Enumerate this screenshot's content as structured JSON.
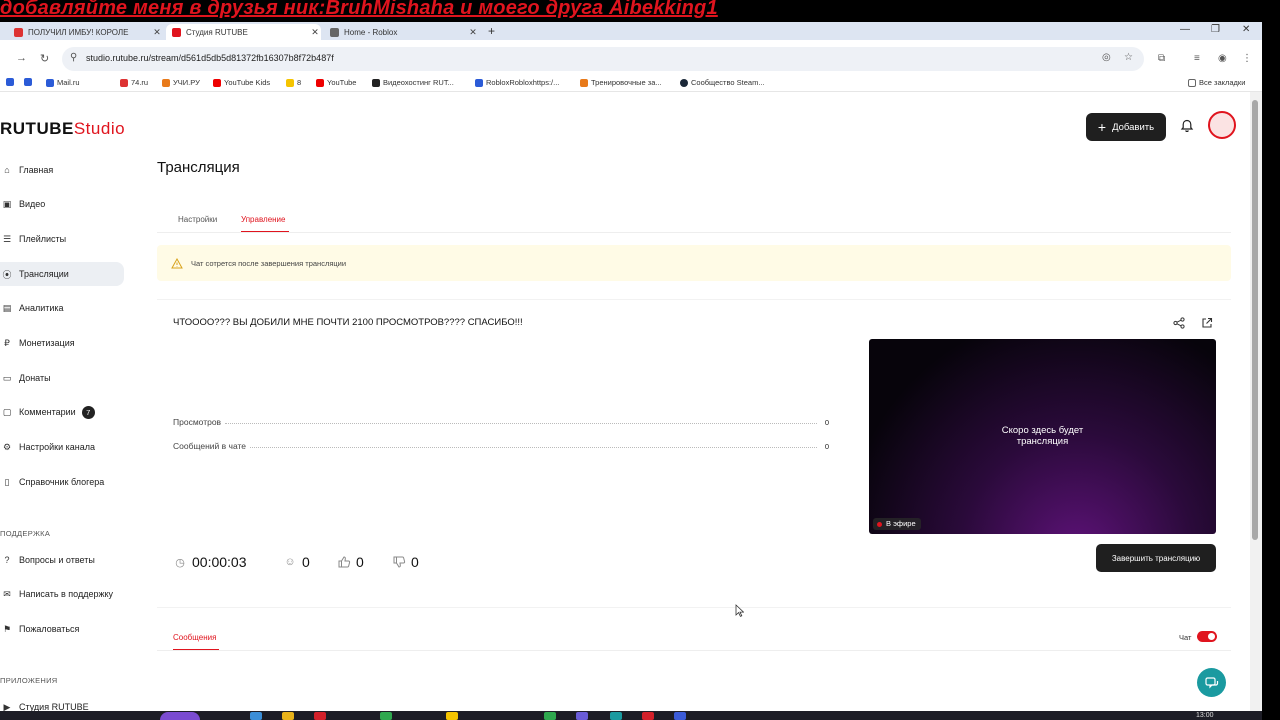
{
  "overlay": {
    "text": "добавляйте меня в друзья ник:BruhMishaha и моего друга Aibekking1"
  },
  "browser": {
    "tabs": [
      {
        "title": "ПОЛУЧИЛ ИМБУ! КОРОЛЕ",
        "favicon_color": "#d33"
      },
      {
        "title": "Студия RUTUBE",
        "favicon_color": "#e0141e"
      },
      {
        "title": "Home - Roblox",
        "favicon_color": "#666"
      }
    ],
    "new_tab": "+",
    "url": "studio.rutube.ru/stream/d561d5db5d81372fb16307b8f72b487f",
    "bookmarks": [
      {
        "label": "",
        "color": "#2b5bd7"
      },
      {
        "label": "",
        "color": "#2b5bd7"
      },
      {
        "label": "Mail.ru",
        "color": "#2b5bd7"
      },
      {
        "label": "74.ru",
        "color": "#d33"
      },
      {
        "label": "УЧИ.РУ",
        "color": "#e87a1a"
      },
      {
        "label": "YouTube Kids",
        "color": "#e00"
      },
      {
        "label": "8",
        "color": "#f5c400"
      },
      {
        "label": "YouTube",
        "color": "#e00"
      },
      {
        "label": "Видеохостинг RUT...",
        "color": "#222"
      },
      {
        "label": "RobloxRobloxhttps:/...",
        "color": "#2b5bd7"
      },
      {
        "label": "Тренировочные за...",
        "color": "#e87a1a"
      },
      {
        "label": "Сообщество Steam...",
        "color": "#1b2838"
      }
    ],
    "all_bookmarks": "Все закладки"
  },
  "header": {
    "logo_main": "RUTUBE",
    "logo_studio": "Studio",
    "add_label": "Добавить"
  },
  "sidebar": {
    "items": [
      {
        "label": "Главная",
        "icon": "home-icon"
      },
      {
        "label": "Видео",
        "icon": "video-icon"
      },
      {
        "label": "Плейлисты",
        "icon": "playlist-icon"
      },
      {
        "label": "Трансляции",
        "icon": "broadcast-icon"
      },
      {
        "label": "Аналитика",
        "icon": "analytics-icon"
      },
      {
        "label": "Монетизация",
        "icon": "ruble-icon"
      },
      {
        "label": "Донаты",
        "icon": "wallet-icon"
      },
      {
        "label": "Комментарии",
        "icon": "comment-icon",
        "badge": "7"
      },
      {
        "label": "Настройки канала",
        "icon": "settings-icon"
      },
      {
        "label": "Справочник блогера",
        "icon": "book-icon"
      }
    ],
    "support_title": "ПОДДЕРЖКА",
    "support_items": [
      {
        "label": "Вопросы и ответы",
        "icon": "question-icon"
      },
      {
        "label": "Написать в поддержку",
        "icon": "mail-icon"
      },
      {
        "label": "Пожаловаться",
        "icon": "flag-icon"
      }
    ],
    "apps_title": "ПРИЛОЖЕНИЯ",
    "apps_items": [
      {
        "label": "Студия RUTUBE",
        "icon": "studio-icon"
      }
    ]
  },
  "main": {
    "title": "Трансляция",
    "tabs": [
      {
        "label": "Настройки"
      },
      {
        "label": "Управление"
      }
    ],
    "warning": "Чат сотрется после завершения трансляции",
    "stream_title": "ЧТОООО??? ВЫ ДОБИЛИ МНЕ ПОЧТИ 2100 ПРОСМОТРОВ???? СПАСИБО!!!",
    "stats": [
      {
        "label": "Просмотров",
        "value": "0"
      },
      {
        "label": "Сообщений в чате",
        "value": "0"
      }
    ],
    "preview_text_1": "Скоро здесь будет",
    "preview_text_2": "трансляция",
    "on_air": "В эфире",
    "metrics": {
      "duration": "00:00:03",
      "viewers": "0",
      "likes": "0",
      "dislikes": "0"
    },
    "end_button": "Завершить трансляцию",
    "chat_tab": "Сообщения",
    "chat_toggle_label": "Чат"
  },
  "taskbar": {
    "clock": "13:00"
  },
  "colors": {
    "accent": "#e0141e",
    "dark_button": "#1f1f1f",
    "help": "#1a9aa0",
    "warning_bg": "#fffbe6"
  }
}
